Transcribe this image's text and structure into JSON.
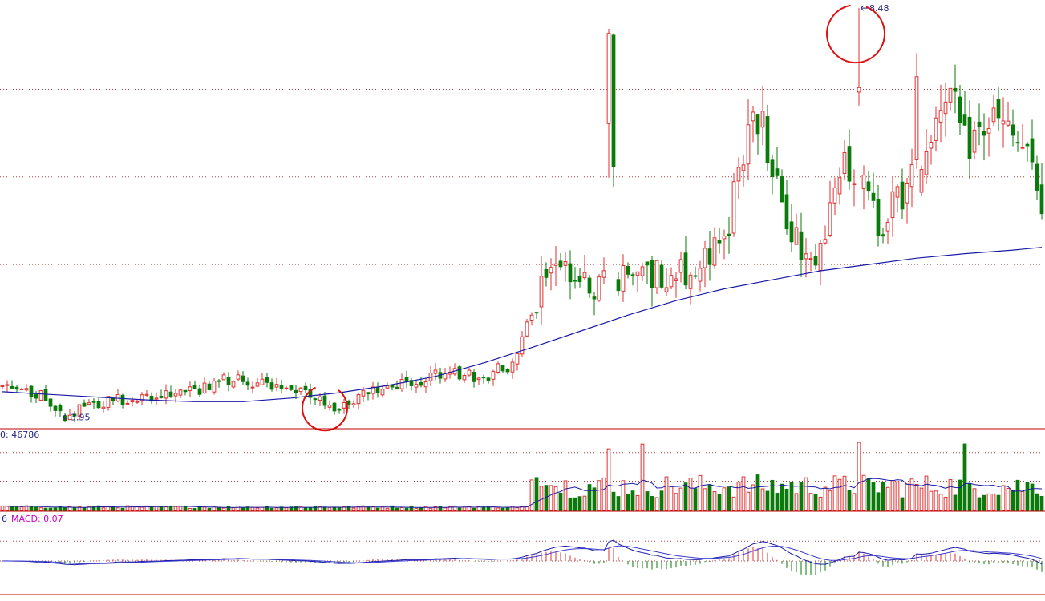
{
  "colors": {
    "up": "#e03030",
    "down": "#0a7a0a",
    "ma": "#1a1aa8",
    "annotation": "#dd1111",
    "separator": "#c00000",
    "grid": "#b04040",
    "text": "#222288",
    "macd_label": "#cc00cc"
  },
  "chart_data": [
    {
      "type": "candlestick",
      "labels": {
        "low": "3.95",
        "high": "8.48"
      },
      "low_value": 3.95,
      "high_value": 8.48,
      "grid": true,
      "grid_levels": [
        7.58,
        6.61,
        5.64
      ],
      "ylim": [
        3.83,
        8.57
      ],
      "moving_average": {
        "x": [
          0,
          10,
          20,
          30,
          40,
          50,
          60,
          70,
          80,
          90,
          100,
          110,
          120,
          130,
          140,
          150,
          160,
          170,
          180,
          190,
          200,
          210,
          216
        ],
        "values": [
          4.23,
          4.2,
          4.17,
          4.14,
          4.12,
          4.12,
          4.16,
          4.22,
          4.3,
          4.4,
          4.55,
          4.72,
          4.9,
          5.08,
          5.24,
          5.37,
          5.47,
          5.57,
          5.64,
          5.71,
          5.76,
          5.8,
          5.83
        ]
      },
      "annotations": [
        "circle around bars 64-70 near the low zone",
        "circle around the 8.48 peak"
      ]
    },
    {
      "type": "volume",
      "label": "0: 46786",
      "grid": true,
      "max_value": 46786,
      "average_line": true
    },
    {
      "type": "macd",
      "labels": {
        "prefix": "6",
        "macd": "MACD: 0.07"
      },
      "value": 0.07,
      "grid": true,
      "lines": [
        "DIF",
        "DEA"
      ],
      "histogram": true
    }
  ]
}
